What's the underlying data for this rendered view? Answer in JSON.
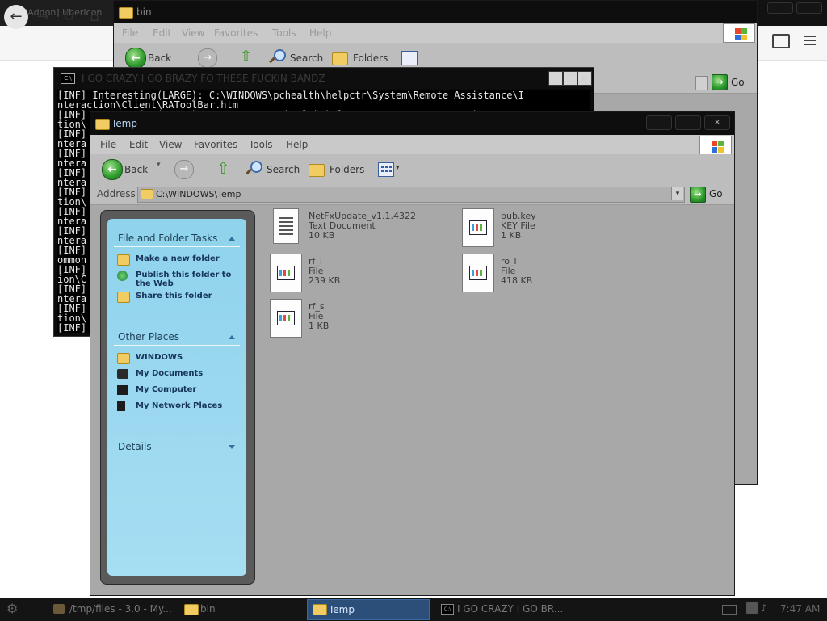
{
  "browser": {
    "tab_title": "[Addon] UberIcon",
    "nav": {
      "back": "←",
      "forward": "→",
      "reload": "↻",
      "home": "⌂"
    }
  },
  "bin_window": {
    "title": "bin",
    "menu": [
      "File",
      "Edit",
      "View",
      "Favorites",
      "Tools",
      "Help"
    ],
    "toolbar": {
      "back": "Back",
      "search": "Search",
      "folders": "Folders"
    },
    "go": "Go"
  },
  "console_window": {
    "title": "I GO CRAZY I GO BRAZY FO THESE FUCKIN BANDZ",
    "lines": [
      "[INF] Interesting(LARGE): C:\\WINDOWS\\pchealth\\helpctr\\System\\Remote Assistance\\I",
      "nteraction\\Client\\RAToolBar.htm",
      "[INF] Interesting(LARGE): C:\\WINDOWS\\pchealth\\helpctr\\System\\Remote Assistance\\I",
      "tion\\",
      "[INF]",
      "ntera",
      "[INF]",
      "ntera",
      "[INF]",
      "ntera",
      "[INF]",
      "tion\\",
      "[INF]",
      "ntera",
      "[INF]",
      "ntera",
      "[INF]",
      "ommon",
      "[INF]",
      "ion\\C",
      "[INF]",
      "ntera",
      "[INF]",
      "tion\\",
      "[INF]"
    ]
  },
  "temp_window": {
    "title": "Temp",
    "menu": [
      "File",
      "Edit",
      "View",
      "Favorites",
      "Tools",
      "Help"
    ],
    "toolbar": {
      "back": "Back",
      "search": "Search",
      "folders": "Folders"
    },
    "address_label": "Address",
    "address_value": "C:\\WINDOWS\\Temp",
    "go": "Go",
    "tasks": {
      "section1_title": "File and Folder Tasks",
      "section1_items": [
        "Make a new folder",
        "Publish this folder to the Web",
        "Share this folder"
      ],
      "section2_title": "Other Places",
      "section2_items": [
        "WINDOWS",
        "My Documents",
        "My Computer",
        "My Network Places"
      ],
      "section3_title": "Details"
    },
    "files": [
      {
        "name": "NetFxUpdate_v1.1.4322",
        "type": "Text Document",
        "size": "10 KB",
        "icon": "text-document-icon"
      },
      {
        "name": "pub.key",
        "type": "KEY File",
        "size": "1 KB",
        "icon": "application-file-icon"
      },
      {
        "name": "rf_l",
        "type": "File",
        "size": "239 KB",
        "icon": "application-file-icon"
      },
      {
        "name": "ro_l",
        "type": "File",
        "size": "418 KB",
        "icon": "application-file-icon"
      },
      {
        "name": "rf_s",
        "type": "File",
        "size": "1 KB",
        "icon": "application-file-icon"
      }
    ]
  },
  "taskbar": {
    "items": [
      {
        "label": "/tmp/files - 3.0 - My..."
      },
      {
        "label": "bin"
      },
      {
        "label": "Temp"
      },
      {
        "label": "I GO CRAZY I GO BR..."
      }
    ],
    "clock": "7:47 AM"
  },
  "colors": {
    "window_body": "#a8a8a8",
    "titlebar": "#0e0e0e",
    "task_pane": "#9ad8ef",
    "taskbar_active": "#2c4f7a"
  }
}
